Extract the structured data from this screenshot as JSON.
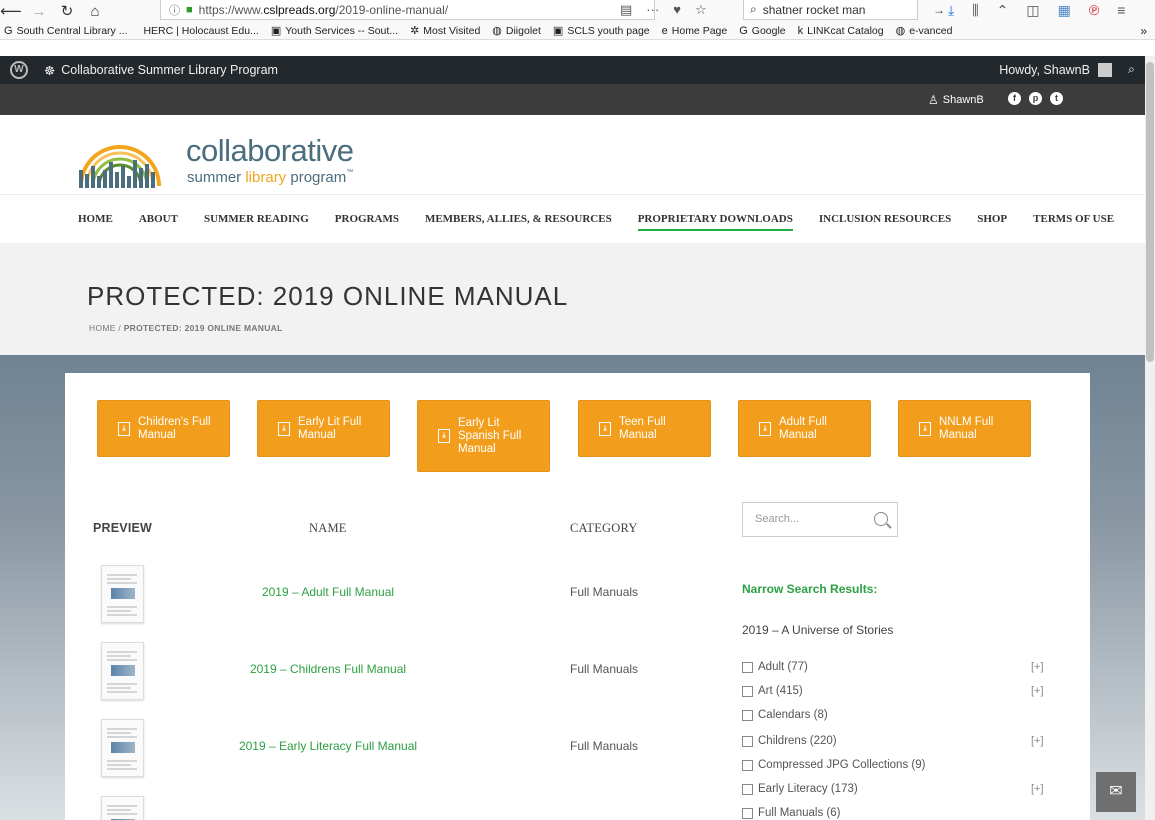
{
  "browser": {
    "url_prefix": "https://www.",
    "url_host": "cslpreads.org",
    "url_path": "/2019-online-manual/",
    "search_value": "shatner rocket man",
    "bookmarks": [
      {
        "icon": "G",
        "label": "South Central Library ..."
      },
      {
        "icon": "",
        "label": "HERC | Holocaust Edu..."
      },
      {
        "icon": "▣",
        "label": "Youth Services -- Sout..."
      },
      {
        "icon": "✲",
        "label": "Most Visited"
      },
      {
        "icon": "◍",
        "label": "Diigolet"
      },
      {
        "icon": "▣",
        "label": "SCLS youth page"
      },
      {
        "icon": "e",
        "label": "Home Page"
      },
      {
        "icon": "G",
        "label": "Google"
      },
      {
        "icon": "k",
        "label": "LINKcat Catalog"
      },
      {
        "icon": "◍",
        "label": "e-vanced"
      }
    ]
  },
  "admin_bar": {
    "site_name": "Collaborative Summer Library Program",
    "greeting": "Howdy, ShawnB"
  },
  "topbar": {
    "username": "ShawnB"
  },
  "logo": {
    "line1": "collaborative",
    "line2_a": "summer ",
    "line2_b": "library",
    "line2_c": " program",
    "tm": "™"
  },
  "nav": {
    "items": [
      "HOME",
      "ABOUT",
      "SUMMER READING",
      "PROGRAMS",
      "MEMBERS, ALLIES, & RESOURCES",
      "PROPRIETARY DOWNLOADS",
      "INCLUSION RESOURCES",
      "SHOP",
      "TERMS OF USE"
    ],
    "active": "PROPRIETARY DOWNLOADS"
  },
  "page": {
    "title": "PROTECTED: 2019 ONLINE MANUAL",
    "breadcrumb_home": "HOME",
    "breadcrumb_sep": " / ",
    "breadcrumb_current": "PROTECTED: 2019 ONLINE MANUAL"
  },
  "manual_buttons": [
    "Children's Full Manual",
    "Early Lit Full Manual",
    "Early Lit Spanish Full Manual",
    "Teen Full Manual",
    "Adult Full Manual",
    "NNLM Full Manual"
  ],
  "table": {
    "headers": {
      "preview": "PREVIEW",
      "name": "NAME",
      "category": "CATEGORY"
    },
    "rows": [
      {
        "name": "2019 – Adult Full Manual",
        "category": "Full Manuals"
      },
      {
        "name": "2019 – Childrens Full Manual",
        "category": "Full Manuals"
      },
      {
        "name": "2019 – Early Literacy Full Manual",
        "category": "Full Manuals"
      }
    ]
  },
  "sidebar": {
    "search_placeholder": "Search...",
    "narrow_title": "Narrow Search Results:",
    "collection": "2019 – A Universe of Stories",
    "expand_label": "[+]",
    "filters": [
      {
        "label": "Adult (77)",
        "expandable": true
      },
      {
        "label": "Art (415)",
        "expandable": true
      },
      {
        "label": "Calendars (8)",
        "expandable": false
      },
      {
        "label": "Childrens (220)",
        "expandable": true
      },
      {
        "label": "Compressed JPG Collections (9)",
        "expandable": false
      },
      {
        "label": "Early Literacy (173)",
        "expandable": true
      },
      {
        "label": "Full Manuals (6)",
        "expandable": false
      }
    ]
  },
  "colors": {
    "accent_orange": "#f29e1c",
    "link_green": "#2ca043",
    "wp_bar": "#23282d"
  }
}
